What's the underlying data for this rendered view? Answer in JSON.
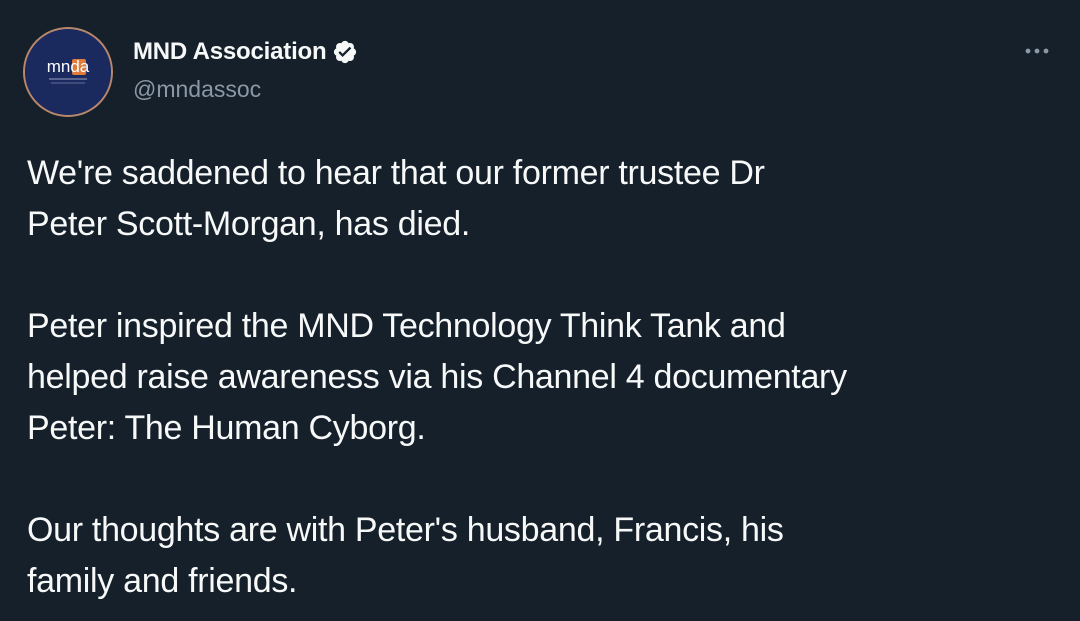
{
  "author": {
    "display_name": "MND Association",
    "handle": "@mndassoc",
    "verified": true,
    "avatar_text": "mnda"
  },
  "tweet": {
    "paragraphs": [
      "We're saddened to hear that our former trustee Dr\nPeter Scott-Morgan, has died.",
      "Peter inspired the MND Technology Think Tank and\nhelped raise awareness via his Channel 4 documentary\nPeter: The Human Cyborg.",
      "Our thoughts are with Peter's husband, Francis, his\nfamily and friends."
    ]
  },
  "icons": {
    "verified": "verified-badge-icon",
    "more": "more-options-icon"
  },
  "colors": {
    "background": "#15202b",
    "text": "#f7f9f9",
    "muted": "#8b98a5",
    "avatar_bg": "#1b2a5e",
    "avatar_accent": "#e07b3c"
  }
}
